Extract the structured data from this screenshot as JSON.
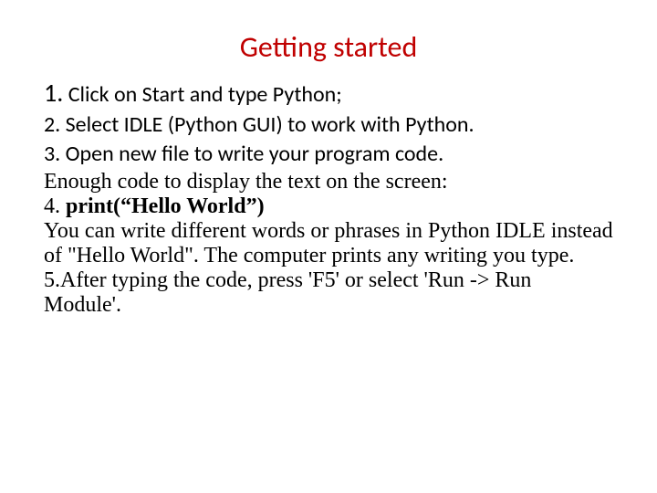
{
  "title": "Getting started",
  "line1_num": "1.",
  "line1_text": " Click on Start and type Python;",
  "line2": "2. Select IDLE (Python GUI) to work with Python.",
  "line3": "3. Open new file to write your program code.",
  "line4": "Enough code to display the text on the screen:",
  "line5_prefix": "4. ",
  "line5_bold": "print(“Hello World”)",
  "line6": "You can write different words or phrases in Python IDLE instead of \"Hello World\". The computer prints any writing you type.",
  "line7": "5.After typing the code, press 'F5' or select 'Run -> Run Module'."
}
